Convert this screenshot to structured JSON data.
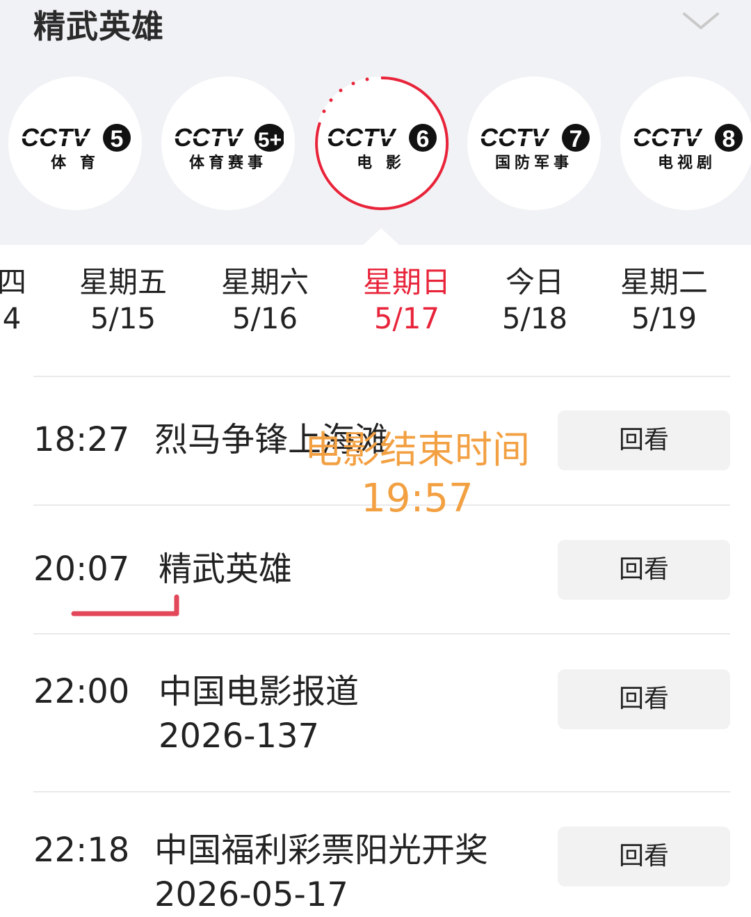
{
  "header": {
    "title": "精武英雄"
  },
  "channels": [
    {
      "logo_text": "CCTV",
      "number": "5",
      "subtitle": "体 育",
      "selected": false
    },
    {
      "logo_text": "CCTV",
      "number": "5+",
      "subtitle": "体育赛事",
      "selected": false
    },
    {
      "logo_text": "CCTV",
      "number": "6",
      "subtitle": "电 影",
      "selected": true
    },
    {
      "logo_text": "CCTV",
      "number": "7",
      "subtitle": "国防军事",
      "selected": false
    },
    {
      "logo_text": "CCTV",
      "number": "8",
      "subtitle": "电视剧",
      "selected": false
    }
  ],
  "days": [
    {
      "name": "四",
      "date": "4"
    },
    {
      "name": "星期五",
      "date": "5/15"
    },
    {
      "name": "星期六",
      "date": "5/16"
    },
    {
      "name": "星期日",
      "date": "5/17",
      "active": true
    },
    {
      "name": "今日",
      "date": "5/18"
    },
    {
      "name": "星期二",
      "date": "5/19"
    }
  ],
  "programs": [
    {
      "time": "18:27",
      "name": "烈马争锋上海滩",
      "action": "回看"
    },
    {
      "time": "20:07",
      "name": "精武英雄",
      "action": "回看"
    },
    {
      "time": "22:00",
      "name": "中国电影报道",
      "name2": "2026-137",
      "action": "回看"
    },
    {
      "time": "22:18",
      "name": "中国福利彩票阳光开奖",
      "name2": "2026-05-17",
      "action": "回看"
    }
  ],
  "annotation": {
    "line1": "电影结束时间",
    "line2": "19:57"
  },
  "colors": {
    "accent_red": "#e8243a",
    "overlay_orange": "#f2a042",
    "underline_red": "#e2475a"
  }
}
